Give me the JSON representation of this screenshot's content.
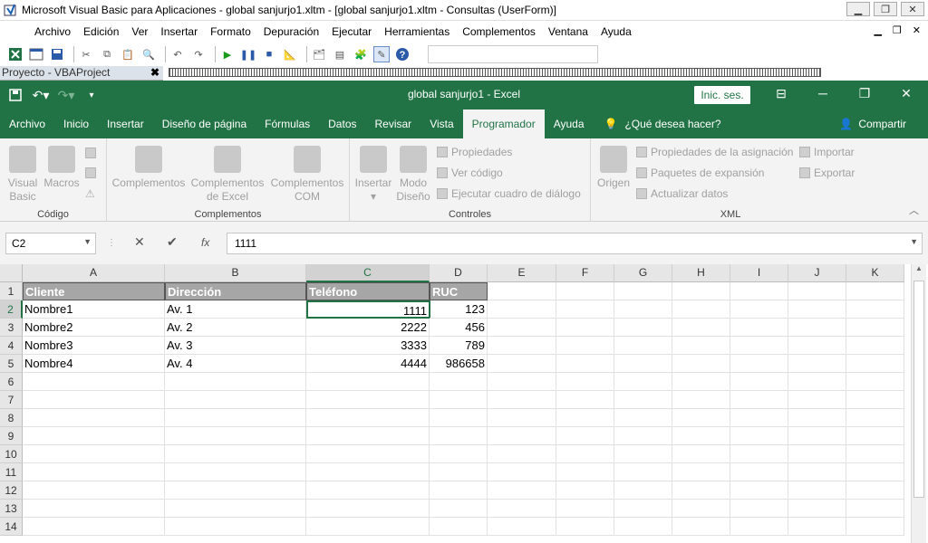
{
  "vbe": {
    "title": "Microsoft Visual Basic para Aplicaciones - global sanjurjo1.xltm - [global sanjurjo1.xltm - Consultas (UserForm)]",
    "menu": [
      "Archivo",
      "Edición",
      "Ver",
      "Insertar",
      "Formato",
      "Depuración",
      "Ejecutar",
      "Herramientas",
      "Complementos",
      "Ventana",
      "Ayuda"
    ],
    "project_bar": "Proyecto - VBAProject",
    "close_glyph": "✖"
  },
  "excel": {
    "title": "global sanjurjo1  -  Excel",
    "signin": "Inic. ses.",
    "tabs": [
      "Archivo",
      "Inicio",
      "Insertar",
      "Diseño de página",
      "Fórmulas",
      "Datos",
      "Revisar",
      "Vista",
      "Programador",
      "Ayuda"
    ],
    "active_tab": "Programador",
    "tell_me": "¿Qué desea hacer?",
    "share": "Compartir"
  },
  "ribbon": {
    "codigo": {
      "label": "Código",
      "visual_basic": "Visual Basic",
      "macros": "Macros"
    },
    "complementos": {
      "label": "Complementos",
      "c1": "Complementos",
      "c2": "Complementos de Excel",
      "c3": "Complementos COM"
    },
    "controles": {
      "label": "Controles",
      "insertar": "Insertar",
      "modo": "Modo Diseño",
      "propiedades": "Propiedades",
      "ver_codigo": "Ver código",
      "ejecutar": "Ejecutar cuadro de diálogo"
    },
    "xml": {
      "label": "XML",
      "origen": "Origen",
      "propiedades_asig": "Propiedades de la asignación",
      "paquetes": "Paquetes de expansión",
      "actualizar": "Actualizar datos",
      "importar": "Importar",
      "exportar": "Exportar"
    }
  },
  "formula_bar": {
    "name_box": "C2",
    "fx": "fx",
    "value": "1111"
  },
  "sheet": {
    "columns": [
      "A",
      "B",
      "C",
      "D",
      "E",
      "F",
      "G",
      "H",
      "I",
      "J",
      "K"
    ],
    "selected_column": "C",
    "rows": [
      "1",
      "2",
      "3",
      "4",
      "5",
      "6",
      "7",
      "8",
      "9",
      "10",
      "11",
      "12",
      "13",
      "14"
    ],
    "selected_row": "2",
    "headers": [
      "Cliente",
      "Dirección",
      "Teléfono",
      "RUC"
    ],
    "data": [
      [
        "Nombre1",
        "Av. 1",
        "1111",
        "123"
      ],
      [
        "Nombre2",
        "Av. 2",
        "2222",
        "456"
      ],
      [
        "Nombre3",
        "Av. 3",
        "3333",
        "789"
      ],
      [
        "Nombre4",
        "Av. 4",
        "4444",
        "986658"
      ]
    ]
  }
}
